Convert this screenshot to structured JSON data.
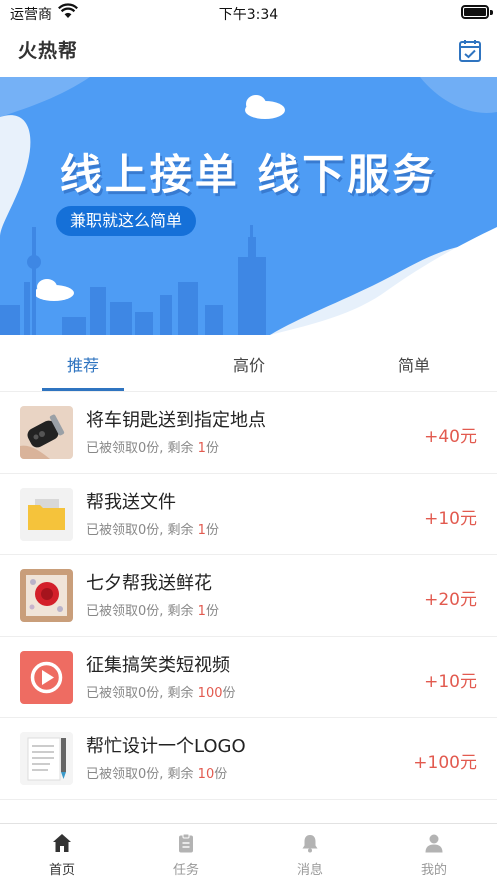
{
  "status_bar": {
    "carrier": "运营商",
    "time": "下午3:34"
  },
  "header": {
    "app_name": "火热帮",
    "task_icon": "calendar-check-icon",
    "accent": "#2f74c0"
  },
  "banner": {
    "headline": "线上接单 线下服务",
    "tagline": "兼职就这么简单"
  },
  "tabs": [
    {
      "label": "推荐",
      "active": true
    },
    {
      "label": "高价",
      "active": false
    },
    {
      "label": "简单",
      "active": false
    }
  ],
  "tasks": [
    {
      "title": "将车钥匙送到指定地点",
      "claimed_prefix": "已被领取0份, 剩余 ",
      "remaining": "1",
      "unit": "份",
      "price": "+40元",
      "thumb": "car-key-thumbnail"
    },
    {
      "title": "帮我送文件",
      "claimed_prefix": "已被领取0份, 剩余 ",
      "remaining": "1",
      "unit": "份",
      "price": "+10元",
      "thumb": "folder-thumbnail"
    },
    {
      "title": "七夕帮我送鲜花",
      "claimed_prefix": "已被领取0份, 剩余 ",
      "remaining": "1",
      "unit": "份",
      "price": "+20元",
      "thumb": "rose-gift-box-thumbnail"
    },
    {
      "title": "征集搞笑类短视频",
      "claimed_prefix": "已被领取0份, 剩余 ",
      "remaining": "100",
      "unit": "份",
      "price": "+10元",
      "thumb": "video-play-thumbnail"
    },
    {
      "title": "帮忙设计一个LOGO",
      "claimed_prefix": "已被领取0份, 剩余 ",
      "remaining": "10",
      "unit": "份",
      "price": "+100元",
      "thumb": "notebook-pen-thumbnail"
    }
  ],
  "price_color": "#e25a4f",
  "bottom_nav": [
    {
      "label": "首页",
      "icon": "home-icon",
      "active": true
    },
    {
      "label": "任务",
      "icon": "clipboard-icon",
      "active": false
    },
    {
      "label": "消息",
      "icon": "bell-icon",
      "active": false
    },
    {
      "label": "我的",
      "icon": "user-icon",
      "active": false
    }
  ]
}
